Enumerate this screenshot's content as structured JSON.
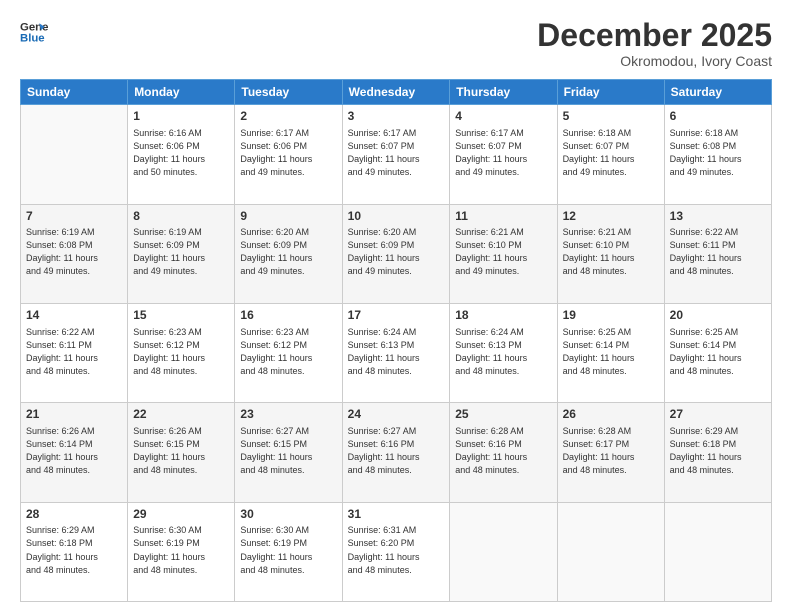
{
  "logo": {
    "line1": "General",
    "line2": "Blue"
  },
  "title": "December 2025",
  "location": "Okromodou, Ivory Coast",
  "weekdays": [
    "Sunday",
    "Monday",
    "Tuesday",
    "Wednesday",
    "Thursday",
    "Friday",
    "Saturday"
  ],
  "weeks": [
    [
      {
        "day": "",
        "info": ""
      },
      {
        "day": "1",
        "info": "Sunrise: 6:16 AM\nSunset: 6:06 PM\nDaylight: 11 hours\nand 50 minutes."
      },
      {
        "day": "2",
        "info": "Sunrise: 6:17 AM\nSunset: 6:06 PM\nDaylight: 11 hours\nand 49 minutes."
      },
      {
        "day": "3",
        "info": "Sunrise: 6:17 AM\nSunset: 6:07 PM\nDaylight: 11 hours\nand 49 minutes."
      },
      {
        "day": "4",
        "info": "Sunrise: 6:17 AM\nSunset: 6:07 PM\nDaylight: 11 hours\nand 49 minutes."
      },
      {
        "day": "5",
        "info": "Sunrise: 6:18 AM\nSunset: 6:07 PM\nDaylight: 11 hours\nand 49 minutes."
      },
      {
        "day": "6",
        "info": "Sunrise: 6:18 AM\nSunset: 6:08 PM\nDaylight: 11 hours\nand 49 minutes."
      }
    ],
    [
      {
        "day": "7",
        "info": "Sunrise: 6:19 AM\nSunset: 6:08 PM\nDaylight: 11 hours\nand 49 minutes."
      },
      {
        "day": "8",
        "info": "Sunrise: 6:19 AM\nSunset: 6:09 PM\nDaylight: 11 hours\nand 49 minutes."
      },
      {
        "day": "9",
        "info": "Sunrise: 6:20 AM\nSunset: 6:09 PM\nDaylight: 11 hours\nand 49 minutes."
      },
      {
        "day": "10",
        "info": "Sunrise: 6:20 AM\nSunset: 6:09 PM\nDaylight: 11 hours\nand 49 minutes."
      },
      {
        "day": "11",
        "info": "Sunrise: 6:21 AM\nSunset: 6:10 PM\nDaylight: 11 hours\nand 49 minutes."
      },
      {
        "day": "12",
        "info": "Sunrise: 6:21 AM\nSunset: 6:10 PM\nDaylight: 11 hours\nand 48 minutes."
      },
      {
        "day": "13",
        "info": "Sunrise: 6:22 AM\nSunset: 6:11 PM\nDaylight: 11 hours\nand 48 minutes."
      }
    ],
    [
      {
        "day": "14",
        "info": "Sunrise: 6:22 AM\nSunset: 6:11 PM\nDaylight: 11 hours\nand 48 minutes."
      },
      {
        "day": "15",
        "info": "Sunrise: 6:23 AM\nSunset: 6:12 PM\nDaylight: 11 hours\nand 48 minutes."
      },
      {
        "day": "16",
        "info": "Sunrise: 6:23 AM\nSunset: 6:12 PM\nDaylight: 11 hours\nand 48 minutes."
      },
      {
        "day": "17",
        "info": "Sunrise: 6:24 AM\nSunset: 6:13 PM\nDaylight: 11 hours\nand 48 minutes."
      },
      {
        "day": "18",
        "info": "Sunrise: 6:24 AM\nSunset: 6:13 PM\nDaylight: 11 hours\nand 48 minutes."
      },
      {
        "day": "19",
        "info": "Sunrise: 6:25 AM\nSunset: 6:14 PM\nDaylight: 11 hours\nand 48 minutes."
      },
      {
        "day": "20",
        "info": "Sunrise: 6:25 AM\nSunset: 6:14 PM\nDaylight: 11 hours\nand 48 minutes."
      }
    ],
    [
      {
        "day": "21",
        "info": "Sunrise: 6:26 AM\nSunset: 6:14 PM\nDaylight: 11 hours\nand 48 minutes."
      },
      {
        "day": "22",
        "info": "Sunrise: 6:26 AM\nSunset: 6:15 PM\nDaylight: 11 hours\nand 48 minutes."
      },
      {
        "day": "23",
        "info": "Sunrise: 6:27 AM\nSunset: 6:15 PM\nDaylight: 11 hours\nand 48 minutes."
      },
      {
        "day": "24",
        "info": "Sunrise: 6:27 AM\nSunset: 6:16 PM\nDaylight: 11 hours\nand 48 minutes."
      },
      {
        "day": "25",
        "info": "Sunrise: 6:28 AM\nSunset: 6:16 PM\nDaylight: 11 hours\nand 48 minutes."
      },
      {
        "day": "26",
        "info": "Sunrise: 6:28 AM\nSunset: 6:17 PM\nDaylight: 11 hours\nand 48 minutes."
      },
      {
        "day": "27",
        "info": "Sunrise: 6:29 AM\nSunset: 6:18 PM\nDaylight: 11 hours\nand 48 minutes."
      }
    ],
    [
      {
        "day": "28",
        "info": "Sunrise: 6:29 AM\nSunset: 6:18 PM\nDaylight: 11 hours\nand 48 minutes."
      },
      {
        "day": "29",
        "info": "Sunrise: 6:30 AM\nSunset: 6:19 PM\nDaylight: 11 hours\nand 48 minutes."
      },
      {
        "day": "30",
        "info": "Sunrise: 6:30 AM\nSunset: 6:19 PM\nDaylight: 11 hours\nand 48 minutes."
      },
      {
        "day": "31",
        "info": "Sunrise: 6:31 AM\nSunset: 6:20 PM\nDaylight: 11 hours\nand 48 minutes."
      },
      {
        "day": "",
        "info": ""
      },
      {
        "day": "",
        "info": ""
      },
      {
        "day": "",
        "info": ""
      }
    ]
  ]
}
